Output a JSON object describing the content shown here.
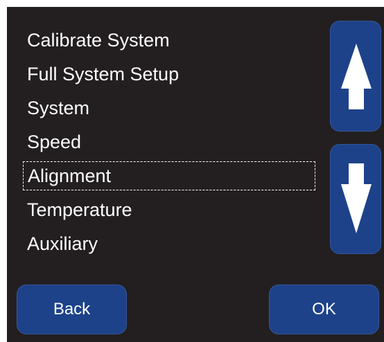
{
  "menu": {
    "items": [
      {
        "label": "Calibrate System",
        "selected": false
      },
      {
        "label": "Full System Setup",
        "selected": false
      },
      {
        "label": "System",
        "selected": false
      },
      {
        "label": "Speed",
        "selected": false
      },
      {
        "label": "Alignment",
        "selected": true
      },
      {
        "label": "Temperature",
        "selected": false
      },
      {
        "label": "Auxiliary",
        "selected": false
      }
    ]
  },
  "scroll": {
    "up_icon": "arrow-up-icon",
    "down_icon": "arrow-down-icon"
  },
  "footer": {
    "back_label": "Back",
    "ok_label": "OK"
  },
  "colors": {
    "background": "#231f20",
    "button": "#1d428a",
    "text": "#ffffff"
  }
}
